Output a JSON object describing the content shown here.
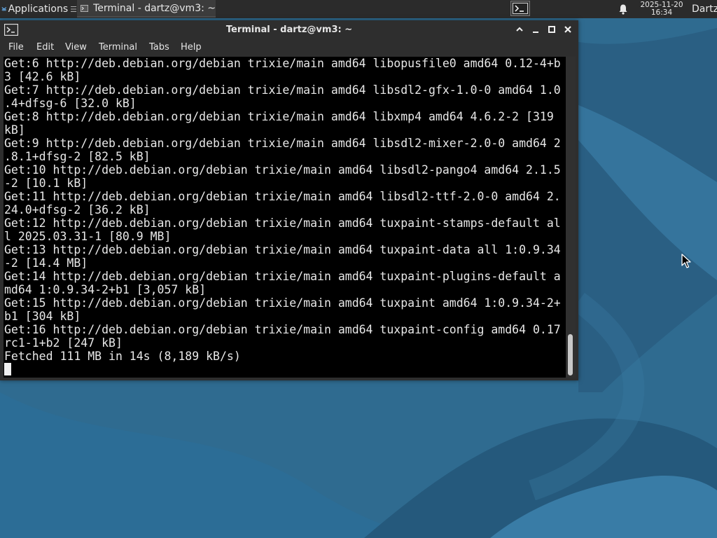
{
  "panel": {
    "applications_label": "Applications",
    "task_label": "Terminal - dartz@vm3: ~",
    "clock_date": "2025-11-20",
    "clock_time": "16:34",
    "user_label": "Dartz"
  },
  "window": {
    "title": "Terminal - dartz@vm3: ~",
    "menu": [
      "File",
      "Edit",
      "View",
      "Terminal",
      "Tabs",
      "Help"
    ]
  },
  "terminal": {
    "lines": [
      "Get:6 http://deb.debian.org/debian trixie/main amd64 libopusfile0 amd64 0.12-4+b",
      "3 [42.6 kB]",
      "Get:7 http://deb.debian.org/debian trixie/main amd64 libsdl2-gfx-1.0-0 amd64 1.0",
      ".4+dfsg-6 [32.0 kB]",
      "Get:8 http://deb.debian.org/debian trixie/main amd64 libxmp4 amd64 4.6.2-2 [319",
      "kB]",
      "Get:9 http://deb.debian.org/debian trixie/main amd64 libsdl2-mixer-2.0-0 amd64 2",
      ".8.1+dfsg-2 [82.5 kB]",
      "Get:10 http://deb.debian.org/debian trixie/main amd64 libsdl2-pango4 amd64 2.1.5",
      "-2 [10.1 kB]",
      "Get:11 http://deb.debian.org/debian trixie/main amd64 libsdl2-ttf-2.0-0 amd64 2.",
      "24.0+dfsg-2 [36.2 kB]",
      "Get:12 http://deb.debian.org/debian trixie/main amd64 tuxpaint-stamps-default al",
      "l 2025.03.31-1 [80.9 MB]",
      "Get:13 http://deb.debian.org/debian trixie/main amd64 tuxpaint-data all 1:0.9.34",
      "-2 [14.4 MB]",
      "Get:14 http://deb.debian.org/debian trixie/main amd64 tuxpaint-plugins-default a",
      "md64 1:0.9.34-2+b1 [3,057 kB]",
      "Get:15 http://deb.debian.org/debian trixie/main amd64 tuxpaint amd64 1:0.9.34-2+",
      "b1 [304 kB]",
      "Get:16 http://deb.debian.org/debian trixie/main amd64 tuxpaint-config amd64 0.17",
      "rc1-1+b2 [247 kB]",
      "Fetched 111 MB in 14s (8,189 kB/s)"
    ]
  },
  "icons": {
    "applications": "xfce-logo-icon",
    "task": "terminal-icon",
    "pager": "terminal-icon",
    "notifications": "bell-icon",
    "window": "terminal-icon",
    "maximize": "chevron-up-icon",
    "minimize": "minimize-icon",
    "restore": "maximize-icon",
    "close": "close-icon",
    "pointer": "mouse-pointer-icon"
  },
  "colors": {
    "panel_bg": "#2b2b2b",
    "window_bg": "#2e2e2e",
    "terminal_bg": "#000000",
    "terminal_fg": "#e8e8e8",
    "desktop_bg": "#2f6f95"
  }
}
